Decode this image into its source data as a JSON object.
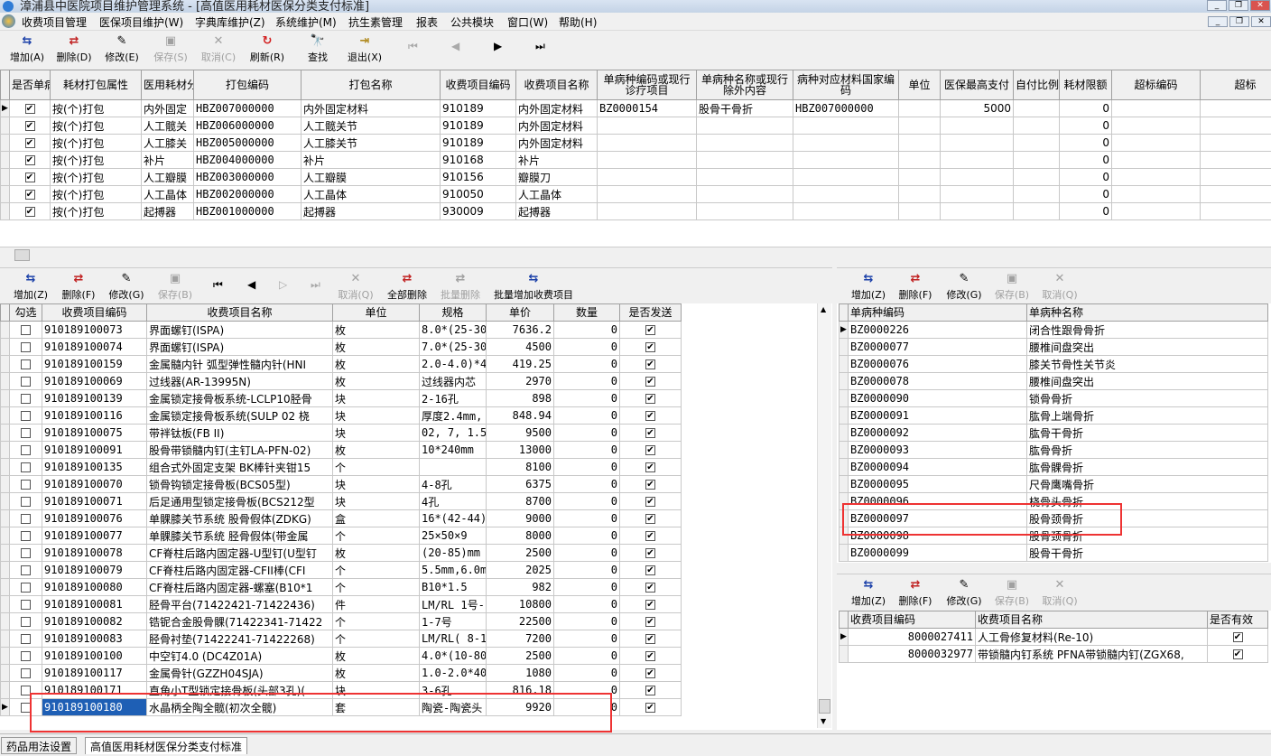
{
  "window": {
    "title": "漳浦县中医院项目维护管理系统 - [高值医用耗材医保分类支付标准]"
  },
  "menu": [
    "收费项目管理",
    "医保项目维护(W)",
    "字典库维护(Z)",
    "系统维护(M)",
    "抗生素管理",
    "报表",
    "公共模块",
    "窗口(W)",
    "帮助(H)"
  ],
  "main_toolbar": [
    {
      "label": "增加(A)",
      "icon": "add-icon",
      "enabled": true
    },
    {
      "label": "删除(D)",
      "icon": "delete-icon",
      "enabled": true
    },
    {
      "label": "修改(E)",
      "icon": "edit-icon",
      "enabled": true
    },
    {
      "label": "保存(S)",
      "icon": "save-icon",
      "enabled": false
    },
    {
      "label": "取消(C)",
      "icon": "cancel-icon",
      "enabled": false
    },
    {
      "label": "刷新(R)",
      "icon": "refresh-icon",
      "enabled": true
    },
    {
      "label": "查找",
      "icon": "binoculars-icon",
      "enabled": true
    },
    {
      "label": "退出(X)",
      "icon": "exit-icon",
      "enabled": true
    }
  ],
  "top_grid": {
    "columns": [
      "是否单病种",
      "耗材打包属性",
      "医用耗材分类",
      "打包编码",
      "打包名称",
      "收费项目编码",
      "收费项目名称",
      "单病种编码或现行诊疗项目",
      "单病种名称或现行除外内容",
      "病种对应材料国家编码",
      "单位",
      "医保最高支付",
      "自付比例%",
      "耗材限额",
      "超标编码",
      "超标"
    ],
    "rows": [
      {
        "c1": "按(个)打包",
        "c2": "内外固定",
        "c3": "HBZ007000000",
        "c4": "内外固定材料",
        "c5": "910189",
        "c6": "内外固定材料",
        "c7": "BZ0000154",
        "c8": "股骨干骨折",
        "c9": "HBZ007000000",
        "c10": "",
        "c11": "5000",
        "c12": "",
        "c13": "0"
      },
      {
        "c1": "按(个)打包",
        "c2": "人工髋关",
        "c3": "HBZ006000000",
        "c4": "人工髋关节",
        "c5": "910189",
        "c6": "内外固定材料",
        "c7": "",
        "c8": "",
        "c9": "",
        "c10": "",
        "c11": "",
        "c12": "",
        "c13": "0"
      },
      {
        "c1": "按(个)打包",
        "c2": "人工膝关",
        "c3": "HBZ005000000",
        "c4": "人工膝关节",
        "c5": "910189",
        "c6": "内外固定材料",
        "c7": "",
        "c8": "",
        "c9": "",
        "c10": "",
        "c11": "",
        "c12": "",
        "c13": "0"
      },
      {
        "c1": "按(个)打包",
        "c2": "补片",
        "c3": "HBZ004000000",
        "c4": "补片",
        "c5": "910168",
        "c6": "补片",
        "c7": "",
        "c8": "",
        "c9": "",
        "c10": "",
        "c11": "",
        "c12": "",
        "c13": "0"
      },
      {
        "c1": "按(个)打包",
        "c2": "人工瓣膜",
        "c3": "HBZ003000000",
        "c4": "人工瓣膜",
        "c5": "910156",
        "c6": "瓣膜刀",
        "c7": "",
        "c8": "",
        "c9": "",
        "c10": "",
        "c11": "",
        "c12": "",
        "c13": "0"
      },
      {
        "c1": "按(个)打包",
        "c2": "人工晶体",
        "c3": "HBZ002000000",
        "c4": "人工晶体",
        "c5": "910050",
        "c6": "人工晶体",
        "c7": "",
        "c8": "",
        "c9": "",
        "c10": "",
        "c11": "",
        "c12": "",
        "c13": "0"
      },
      {
        "c1": "按(个)打包",
        "c2": "起搏器",
        "c3": "HBZ001000000",
        "c4": "起搏器",
        "c5": "930009",
        "c6": "起搏器",
        "c7": "",
        "c8": "",
        "c9": "",
        "c10": "",
        "c11": "",
        "c12": "",
        "c13": "0"
      }
    ]
  },
  "left_toolbar": [
    {
      "label": "增加(Z)",
      "icon": "add-icon",
      "enabled": true
    },
    {
      "label": "删除(F)",
      "icon": "delete-icon",
      "enabled": true
    },
    {
      "label": "修改(G)",
      "icon": "edit-icon",
      "enabled": true
    },
    {
      "label": "保存(B)",
      "icon": "save-icon",
      "enabled": false
    },
    {
      "label": "取消(Q)",
      "icon": "cancel-icon",
      "enabled": false
    },
    {
      "label": "全部删除",
      "icon": "delete-all-icon",
      "enabled": true
    },
    {
      "label": "批量删除",
      "icon": "batch-delete-icon",
      "enabled": false
    },
    {
      "label": "批量增加收费项目",
      "icon": "batch-add-icon",
      "enabled": true
    }
  ],
  "left_grid": {
    "columns": [
      "勾选",
      "收费项目编码",
      "收费项目名称",
      "单位",
      "规格",
      "单价",
      "数量",
      "是否发送"
    ],
    "rows": [
      {
        "code": "910189100073",
        "name": "界面螺钉(ISPA)",
        "unit": "枚",
        "spec": "8.0*(25-30",
        "price": "7636.2",
        "qty": "0"
      },
      {
        "code": "910189100074",
        "name": "界面螺钉(ISPA)",
        "unit": "枚",
        "spec": "7.0*(25-30",
        "price": "4500",
        "qty": "0"
      },
      {
        "code": "910189100159",
        "name": "金属髓内针 弧型弹性髓内针(HNI",
        "unit": "枚",
        "spec": "2.0-4.0)*4",
        "price": "419.25",
        "qty": "0"
      },
      {
        "code": "910189100069",
        "name": "过线器(AR-13995N)",
        "unit": "枚",
        "spec": "过线器内芯",
        "price": "2970",
        "qty": "0"
      },
      {
        "code": "910189100139",
        "name": "金属锁定接骨板系统-LCLP10胫骨",
        "unit": "块",
        "spec": "2-16孔",
        "price": "898",
        "qty": "0"
      },
      {
        "code": "910189100116",
        "name": "金属锁定接骨板系统(SULP 02 桡",
        "unit": "块",
        "spec": "厚度2.4mm,",
        "price": "848.94",
        "qty": "0"
      },
      {
        "code": "910189100075",
        "name": "带袢钛板(FB II)",
        "unit": "块",
        "spec": "02, 7, 1.5",
        "price": "9500",
        "qty": "0"
      },
      {
        "code": "910189100091",
        "name": "股骨带锁髓内钉(主钉LA-PFN-02)",
        "unit": "枚",
        "spec": "10*240mm",
        "price": "13000",
        "qty": "0"
      },
      {
        "code": "910189100135",
        "name": "组合式外固定支架 BK棒针夹钳15",
        "unit": "个",
        "spec": "",
        "price": "8100",
        "qty": "0"
      },
      {
        "code": "910189100070",
        "name": "锁骨钩锁定接骨板(BCS05型)",
        "unit": "块",
        "spec": "4-8孔",
        "price": "6375",
        "qty": "0"
      },
      {
        "code": "910189100071",
        "name": "后足通用型锁定接骨板(BCS212型",
        "unit": "块",
        "spec": "4孔",
        "price": "8700",
        "qty": "0"
      },
      {
        "code": "910189100076",
        "name": "单髁膝关节系统 股骨假体(ZDKG)",
        "unit": "盒",
        "spec": "16*(42-44)",
        "price": "9000",
        "qty": "0"
      },
      {
        "code": "910189100077",
        "name": "单髁膝关节系统 胫骨假体(带金属",
        "unit": "个",
        "spec": "25×50×9",
        "price": "8000",
        "qty": "0"
      },
      {
        "code": "910189100078",
        "name": "CF脊柱后路内固定器-U型钉(U型钉",
        "unit": "枚",
        "spec": "(20-85)mm",
        "price": "2500",
        "qty": "0"
      },
      {
        "code": "910189100079",
        "name": "CF脊柱后路内固定器-CFII棒(CFI",
        "unit": "个",
        "spec": "5.5mm,6.0m",
        "price": "2025",
        "qty": "0"
      },
      {
        "code": "910189100080",
        "name": "CF脊柱后路内固定器-螺塞(B10*1",
        "unit": "个",
        "spec": "B10*1.5",
        "price": "982",
        "qty": "0"
      },
      {
        "code": "910189100081",
        "name": "胫骨平台(71422421-71422436)",
        "unit": "件",
        "spec": "LM/RL 1号-",
        "price": "10800",
        "qty": "0"
      },
      {
        "code": "910189100082",
        "name": "锆铌合金股骨髁(71422341-71422",
        "unit": "个",
        "spec": "1-7号",
        "price": "22500",
        "qty": "0"
      },
      {
        "code": "910189100083",
        "name": "胫骨衬垫(71422241-71422268)",
        "unit": "个",
        "spec": "LM/RL( 8-1",
        "price": "7200",
        "qty": "0"
      },
      {
        "code": "910189100100",
        "name": "中空钉4.0 (DC4Z01A)",
        "unit": "枚",
        "spec": "4.0*(10-80",
        "price": "2500",
        "qty": "0"
      },
      {
        "code": "910189100117",
        "name": "金属骨针(GZZH04SJA)",
        "unit": "枚",
        "spec": "1.0-2.0*40",
        "price": "1080",
        "qty": "0"
      },
      {
        "code": "910189100171",
        "name": "直角小T型锁定接骨板(头部3孔)(",
        "unit": "块",
        "spec": "3-6孔",
        "price": "816.18",
        "qty": "0"
      },
      {
        "code": "910189100180",
        "name": "水晶柄全陶全髋(初次全髋)",
        "unit": "套",
        "spec": "陶瓷-陶瓷头",
        "price": "9920",
        "qty": "0"
      }
    ]
  },
  "right_top_toolbar": [
    {
      "label": "增加(Z)",
      "icon": "add-icon",
      "enabled": true
    },
    {
      "label": "删除(F)",
      "icon": "delete-icon",
      "enabled": true
    },
    {
      "label": "修改(G)",
      "icon": "edit-icon",
      "enabled": true
    },
    {
      "label": "保存(B)",
      "icon": "save-icon",
      "enabled": false
    },
    {
      "label": "取消(Q)",
      "icon": "cancel-icon",
      "enabled": false
    }
  ],
  "disease_grid": {
    "columns": [
      "单病种编码",
      "单病种名称"
    ],
    "rows": [
      {
        "code": "BZ0000226",
        "name": "闭合性跟骨骨折"
      },
      {
        "code": "BZ0000077",
        "name": "腰椎间盘突出"
      },
      {
        "code": "BZ0000076",
        "name": "膝关节骨性关节炎"
      },
      {
        "code": "BZ0000078",
        "name": "腰椎间盘突出"
      },
      {
        "code": "BZ0000090",
        "name": "锁骨骨折"
      },
      {
        "code": "BZ0000091",
        "name": "肱骨上端骨折"
      },
      {
        "code": "BZ0000092",
        "name": "肱骨干骨折"
      },
      {
        "code": "BZ0000093",
        "name": "肱骨骨折"
      },
      {
        "code": "BZ0000094",
        "name": "肱骨髁骨折"
      },
      {
        "code": "BZ0000095",
        "name": "尺骨鹰嘴骨折"
      },
      {
        "code": "BZ0000096",
        "name": "桡骨头骨折"
      },
      {
        "code": "BZ0000097",
        "name": "股骨颈骨折"
      },
      {
        "code": "BZ0000098",
        "name": "股骨颈骨折"
      },
      {
        "code": "BZ0000099",
        "name": "股骨干骨折"
      }
    ]
  },
  "right_bottom_toolbar": [
    {
      "label": "增加(Z)",
      "icon": "add-icon",
      "enabled": true
    },
    {
      "label": "删除(F)",
      "icon": "delete-icon",
      "enabled": true
    },
    {
      "label": "修改(G)",
      "icon": "edit-icon",
      "enabled": true
    },
    {
      "label": "保存(B)",
      "icon": "save-icon",
      "enabled": false
    },
    {
      "label": "取消(Q)",
      "icon": "cancel-icon",
      "enabled": false
    }
  ],
  "fee_grid": {
    "columns": [
      "收费项目编码",
      "收费项目名称",
      "是否有效"
    ],
    "rows": [
      {
        "code": "8000027411",
        "name": "人工骨修复材料(Re-10)"
      },
      {
        "code": "8000032977",
        "name": "带锁髓内钉系统 PFNA带锁髓内钉(ZGX68,"
      }
    ]
  },
  "bottom_tabs": [
    "药品用法设置",
    "高值医用耗材医保分类支付标准"
  ],
  "colors": {
    "selection": "#1e5fb5",
    "highlight_box": "#e33333",
    "enabled_icon": "#1a3fa8",
    "refresh_icon": "#d21f1f"
  }
}
